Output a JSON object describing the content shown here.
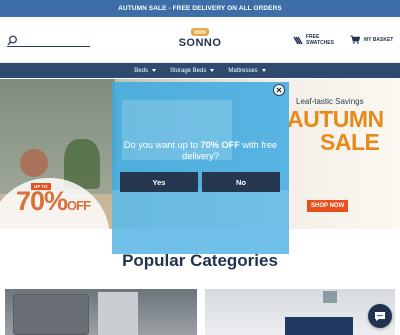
{
  "announcement": "AUTUMN SALE - FREE DELIVERY ON ALL ORDERS",
  "header": {
    "logo": "SONNO",
    "swatches_line1": "FREE",
    "swatches_line2": "SWATCHES",
    "basket": "MY BASKET",
    "search_icon": "search-icon"
  },
  "nav": {
    "items": [
      "Beds",
      "Storage Beds",
      "Mattresses"
    ]
  },
  "hero": {
    "tag": "UP TO",
    "big_number": "70%",
    "big_suffix": "OFF",
    "tagline": "Leaf-tastic Savings",
    "autumn": "AUTUMN",
    "sale": "SALE",
    "shop_now": "SHOP NOW"
  },
  "popup": {
    "question_prefix": "Do you want up to ",
    "question_highlight": "70% OFF",
    "question_suffix": " with free delivery?",
    "yes": "Yes",
    "no": "No",
    "close_icon": "close-icon"
  },
  "popular": {
    "title": "Popular Categories"
  },
  "colors": {
    "announce_bg": "#3d6ea8",
    "nav_bg": "#2e4a6e",
    "navy": "#1f3350",
    "modal_bg": "#3eaae1",
    "accent_orange": "#e8511d"
  }
}
